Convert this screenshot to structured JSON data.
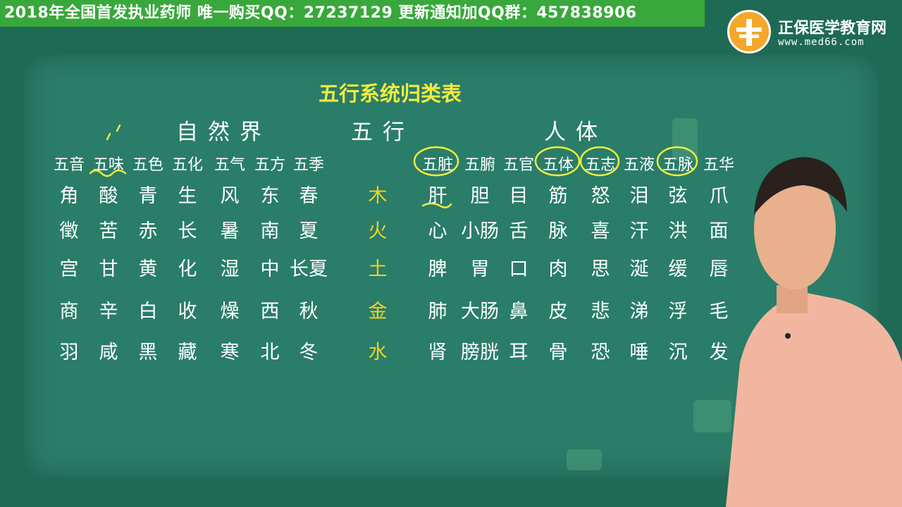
{
  "banner": {
    "text": "2018年全国首发执业药师 唯一购买QQ：27237129  更新通知加QQ群：457838906",
    "color": "#39a83c"
  },
  "logo": {
    "name": "正保医学教育网",
    "url": "www.med66.com",
    "icon": "med66-cross-logo-icon"
  },
  "board": {
    "title": "五行系统归类表",
    "headers": {
      "nature": "自然界",
      "element": "五行",
      "body": "人体"
    },
    "nature_subheads": [
      "五音",
      "五味",
      "五色",
      "五化",
      "五气",
      "五方",
      "五季"
    ],
    "body_subheads": [
      "五脏",
      "五腑",
      "五官",
      "五体",
      "五志",
      "五液",
      "五脉",
      "五华"
    ],
    "rows": [
      {
        "nature": [
          "角",
          "酸",
          "青",
          "生",
          "风",
          "东",
          "春"
        ],
        "element": "木",
        "body": [
          "肝",
          "胆",
          "目",
          "筋",
          "怒",
          "泪",
          "弦",
          "爪"
        ]
      },
      {
        "nature": [
          "徵",
          "苦",
          "赤",
          "长",
          "暑",
          "南",
          "夏"
        ],
        "element": "火",
        "body": [
          "心",
          "小肠",
          "舌",
          "脉",
          "喜",
          "汗",
          "洪",
          "面"
        ]
      },
      {
        "nature": [
          "宫",
          "甘",
          "黄",
          "化",
          "湿",
          "中",
          "长夏"
        ],
        "element": "土",
        "body": [
          "脾",
          "胃",
          "口",
          "肉",
          "思",
          "涎",
          "缓",
          "唇"
        ]
      },
      {
        "nature": [
          "商",
          "辛",
          "白",
          "收",
          "燥",
          "西",
          "秋"
        ],
        "element": "金",
        "body": [
          "肺",
          "大肠",
          "鼻",
          "皮",
          "悲",
          "涕",
          "浮",
          "毛"
        ]
      },
      {
        "nature": [
          "羽",
          "咸",
          "黑",
          "藏",
          "寒",
          "北",
          "冬"
        ],
        "element": "水",
        "body": [
          "肾",
          "膀胱",
          "耳",
          "骨",
          "恐",
          "唾",
          "沉",
          "发"
        ]
      }
    ],
    "highlight_color": "#f2ec3e",
    "element_color": "#f2d21e"
  }
}
